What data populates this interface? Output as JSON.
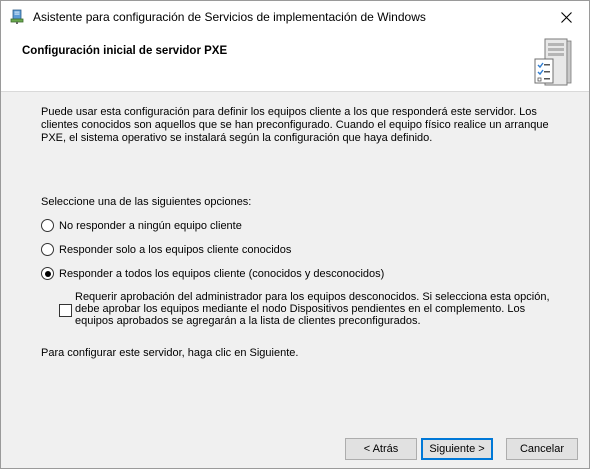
{
  "window": {
    "title": "Asistente para configuración de Servicios de implementación de Windows",
    "close_icon": "close-icon"
  },
  "header": {
    "page_title": "Configuración inicial de servidor PXE",
    "icon": "server-checklist-icon"
  },
  "main": {
    "description": "Puede usar esta configuración para definir los equipos cliente a los que responderá este servidor. Los clientes conocidos son aquellos que se han preconfigurado. Cuando el equipo físico realice un arranque PXE, el sistema operativo se instalará según la configuración que haya definido.",
    "prompt": "Seleccione una de las siguientes opciones:",
    "options": [
      {
        "label": "No responder a ningún equipo cliente",
        "selected": false
      },
      {
        "label": "Responder solo a los equipos cliente conocidos",
        "selected": false
      },
      {
        "label": "Responder a todos los equipos cliente (conocidos y desconocidos)",
        "selected": true
      }
    ],
    "approval_checkbox": {
      "label": "Requerir aprobación del administrador para los equipos desconocidos. Si selecciona esta opción, debe aprobar los equipos mediante el nodo Dispositivos pendientes en el complemento. Los equipos aprobados se agregarán a la lista de clientes preconfigurados.",
      "checked": false
    },
    "footer_text": "Para configurar este servidor, haga clic en Siguiente."
  },
  "buttons": {
    "back": "< Atrás",
    "next": "Siguiente >",
    "cancel": "Cancelar"
  }
}
